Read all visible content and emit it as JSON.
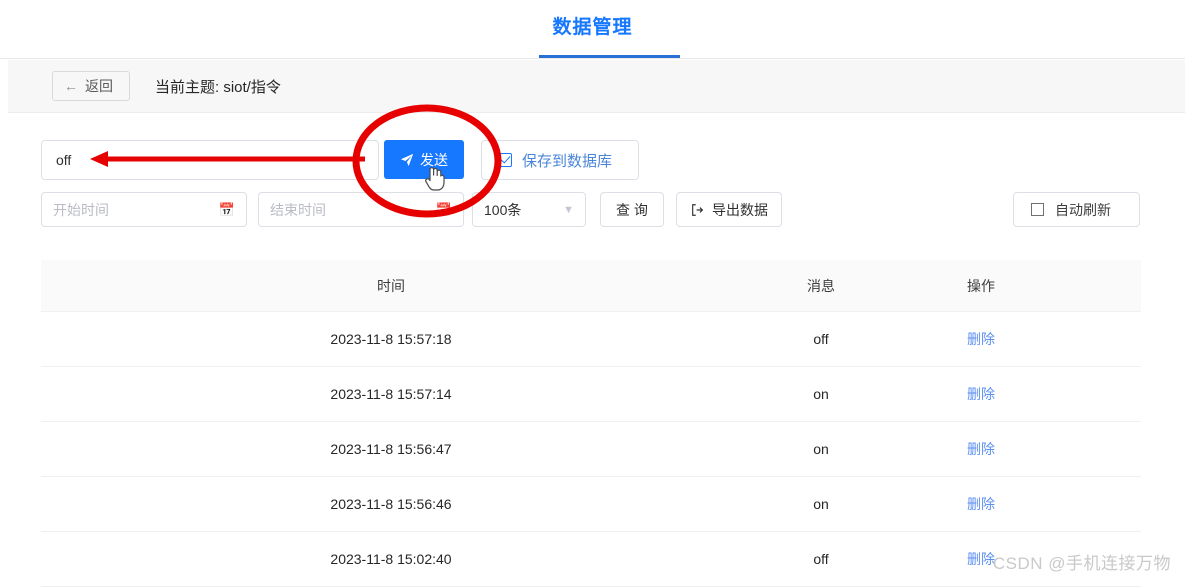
{
  "header": {
    "tab_label": "数据管理",
    "accent_color": "#1677ff",
    "underline_color": "#2a6fd6"
  },
  "subheader": {
    "back_label": "返回",
    "back_icon": "arrow-left-icon",
    "topic_text": "当前主题: siot/指令"
  },
  "send_row": {
    "message_value": "off",
    "message_placeholder": "",
    "send_label": "发送",
    "send_icon": "paper-plane-icon",
    "save_to_db_label": "保存到数据库",
    "save_to_db_checked": true
  },
  "filter_row": {
    "start_time_placeholder": "开始时间",
    "end_time_placeholder": "结束时间",
    "calendar_icon": "calendar-icon",
    "limit_value": "100条",
    "limit_chevron": "chevron-down-icon",
    "query_label": "查 询",
    "export_label": "导出数据",
    "export_icon": "export-icon",
    "auto_refresh_label": "自动刷新",
    "auto_refresh_checked": false
  },
  "table": {
    "columns": [
      "时间",
      "消息",
      "操作"
    ],
    "delete_label": "删除",
    "rows": [
      {
        "time": "2023-11-8 15:57:18",
        "message": "off",
        "action": "删除"
      },
      {
        "time": "2023-11-8 15:57:14",
        "message": "on",
        "action": "删除"
      },
      {
        "time": "2023-11-8 15:56:47",
        "message": "on",
        "action": "删除"
      },
      {
        "time": "2023-11-8 15:56:46",
        "message": "on",
        "action": "删除"
      },
      {
        "time": "2023-11-8 15:02:40",
        "message": "off",
        "action": "删除"
      }
    ]
  },
  "annotations": {
    "color": "#e60000",
    "ellipse_target": "发送",
    "arrow_target": "off"
  },
  "watermark": {
    "text": "CSDN @手机连接万物"
  }
}
